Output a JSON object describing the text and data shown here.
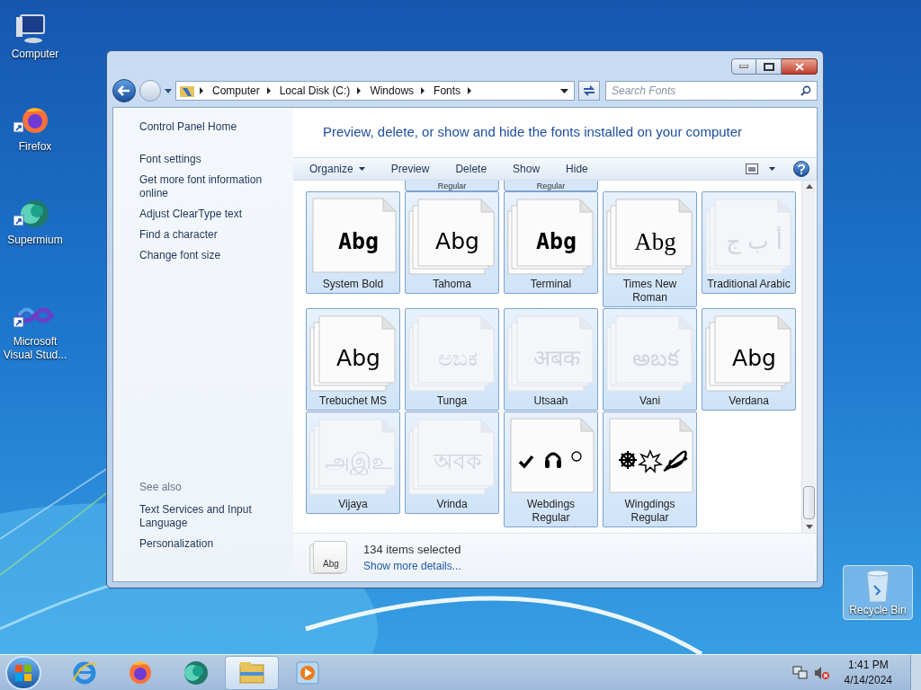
{
  "desktop_icons": [
    {
      "label": "Computer",
      "kind": "computer",
      "selected": false
    },
    {
      "label": "Firefox",
      "kind": "firefox",
      "selected": false
    },
    {
      "label": "Supermium",
      "kind": "supermium",
      "selected": false
    },
    {
      "label": "Microsoft Visual Stud...",
      "kind": "vs",
      "selected": false
    },
    {
      "label": "Recycle Bin",
      "kind": "recycle",
      "selected": true
    }
  ],
  "window": {
    "address": [
      "Computer",
      "Local Disk (C:)",
      "Windows",
      "Fonts"
    ],
    "search": {
      "placeholder": "Search Fonts"
    },
    "sidebar": {
      "links": [
        "Control Panel Home",
        "Font settings",
        "Get more font information online",
        "Adjust ClearType text",
        "Find a character",
        "Change font size"
      ],
      "see_also_title": "See also",
      "see_also": [
        "Text Services and Input Language",
        "Personalization"
      ]
    },
    "heading": "Preview, delete, or show and hide the fonts installed on your computer",
    "toolbar": [
      {
        "label": "Organize",
        "dropdown": true
      },
      {
        "label": "Preview",
        "dropdown": false
      },
      {
        "label": "Delete",
        "dropdown": false
      },
      {
        "label": "Show",
        "dropdown": false
      },
      {
        "label": "Hide",
        "dropdown": false
      }
    ],
    "partial_row": [
      {
        "label": "Regular"
      },
      {
        "label": "Regular"
      }
    ],
    "fonts": [
      {
        "label": "System Bold",
        "sample": "Abg",
        "kind": "pixel",
        "stack": false,
        "hidden": false,
        "selected": true
      },
      {
        "label": "Tahoma",
        "sample": "Abg",
        "kind": "sans",
        "stack": true,
        "hidden": false,
        "selected": true
      },
      {
        "label": "Terminal",
        "sample": "Abg",
        "kind": "pixel",
        "stack": true,
        "hidden": false,
        "selected": true
      },
      {
        "label": "Times New Roman",
        "sample": "Abg",
        "kind": "serif",
        "stack": true,
        "hidden": false,
        "selected": true
      },
      {
        "label": "Traditional Arabic",
        "sample": "أ ب ج",
        "kind": "sans",
        "stack": true,
        "hidden": true,
        "selected": true
      },
      {
        "label": "Trebuchet MS",
        "sample": "Abg",
        "kind": "sans",
        "stack": true,
        "hidden": false,
        "selected": true
      },
      {
        "label": "Tunga",
        "sample": "ಅಬಕ",
        "kind": "sans",
        "stack": true,
        "hidden": true,
        "selected": true
      },
      {
        "label": "Utsaah",
        "sample": "अबक",
        "kind": "sans",
        "stack": true,
        "hidden": true,
        "selected": true
      },
      {
        "label": "Vani",
        "sample": "అబక",
        "kind": "sans",
        "stack": true,
        "hidden": true,
        "selected": true
      },
      {
        "label": "Verdana",
        "sample": "Abg",
        "kind": "sans",
        "stack": true,
        "hidden": false,
        "selected": true
      },
      {
        "label": "Vijaya",
        "sample": "அஇஉ",
        "kind": "sans",
        "stack": true,
        "hidden": true,
        "selected": true
      },
      {
        "label": "Vrinda",
        "sample": "অবক",
        "kind": "sans",
        "stack": true,
        "hidden": true,
        "selected": true
      },
      {
        "label": "Webdings Regular",
        "kind": "webdings",
        "stack": false,
        "hidden": false,
        "selected": true
      },
      {
        "label": "Wingdings Regular",
        "kind": "wingdings",
        "stack": false,
        "hidden": false,
        "selected": true
      }
    ],
    "details": {
      "icon_sample": "Abg",
      "count": "134 items selected",
      "link": "Show more details..."
    }
  },
  "taskbar": {
    "apps": [
      {
        "kind": "ie",
        "active": false
      },
      {
        "kind": "firefox",
        "active": false
      },
      {
        "kind": "supermium",
        "active": false
      },
      {
        "kind": "explorer",
        "active": true
      },
      {
        "kind": "media",
        "active": false
      }
    ],
    "time": "1:41 PM",
    "date": "4/14/2024"
  }
}
